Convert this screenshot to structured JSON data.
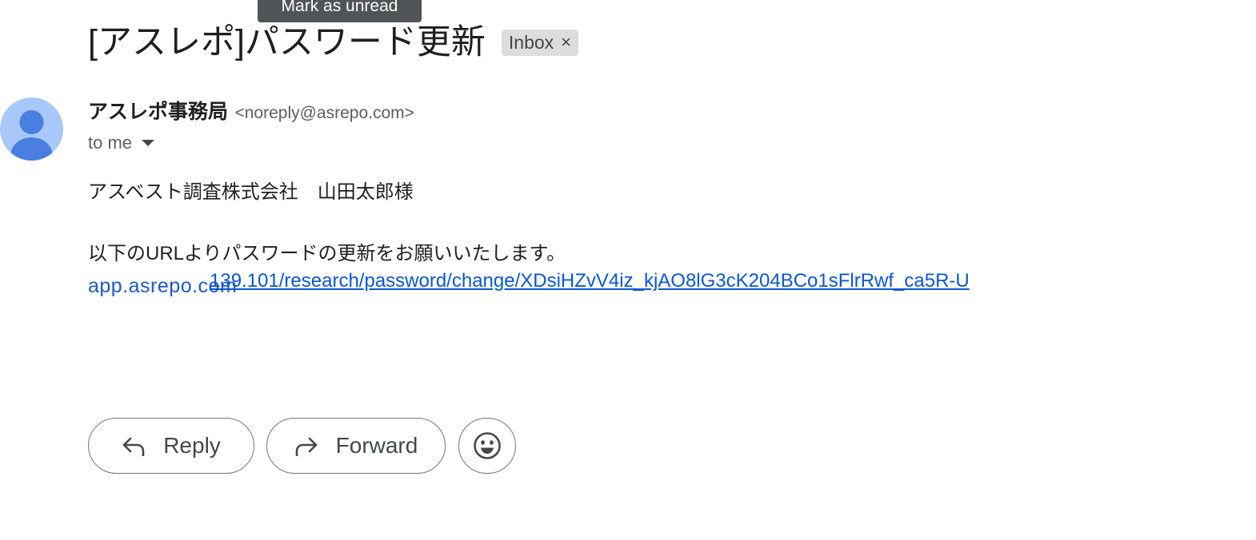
{
  "tooltip": {
    "text": "Mark as unread"
  },
  "subject": {
    "title": "[アスレポ]パスワード更新",
    "label": "Inbox",
    "label_remove": "×"
  },
  "sender": {
    "name": "アスレポ事務局",
    "email": "<noreply@asrepo.com>",
    "recipient": "to me"
  },
  "body": {
    "greeting": "アスベスト調査株式会社　山田太郎様",
    "instruction": "以下のURLよりパスワードの更新をお願いいたします。",
    "link_display": "app.asrepo.com",
    "link_url": "139.101/research/password/change/XDsiHZvV4iz_kjAO8lG3cK204BCo1sFlrRwf_ca5R-U"
  },
  "actions": {
    "reply_label": "Reply",
    "forward_label": "Forward"
  },
  "colors": {
    "link": "#0b57d0",
    "avatar_bg": "#a8c7fa",
    "avatar_fg": "#4a7ee0",
    "chip_bg": "#dddddd",
    "tooltip_bg": "#505458"
  },
  "icons": [
    "person-icon",
    "chevron-down-icon",
    "close-icon",
    "reply-icon",
    "forward-icon",
    "emoji-icon"
  ]
}
